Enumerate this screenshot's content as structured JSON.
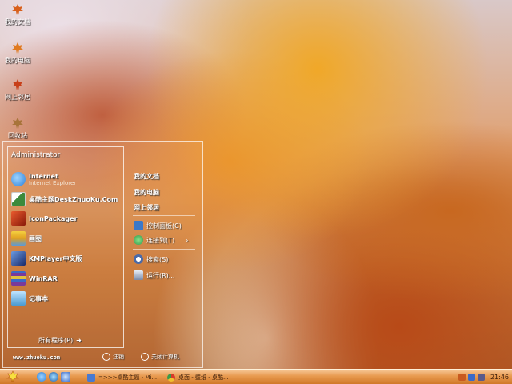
{
  "desktop": {
    "icons": [
      {
        "label": "我的文档",
        "icon": "maple-leaf-icon"
      },
      {
        "label": "我的电脑",
        "icon": "maple-leaf-icon"
      },
      {
        "label": "网上邻居",
        "icon": "maple-leaf-icon"
      },
      {
        "label": "回收站",
        "icon": "maple-leaf-icon"
      }
    ]
  },
  "start_menu": {
    "user": "Administrator",
    "programs": [
      {
        "title": "Internet",
        "subtitle": "Internet Explorer",
        "icon": "ie-icon",
        "color": "#2a7fd8"
      },
      {
        "title": "桌酷主题DeskZhuoKu.Com",
        "icon": "theme-icon",
        "color": "#3c8a3c"
      },
      {
        "title": "IconPackager",
        "icon": "iconpackager-icon",
        "color": "#c83a1e"
      },
      {
        "title": "画图",
        "icon": "paint-icon",
        "color": "#e0a020"
      },
      {
        "title": "KMPlayer中文版",
        "icon": "kmplayer-icon",
        "color": "#2a4a8a"
      },
      {
        "title": "WinRAR",
        "icon": "winrar-icon",
        "color": "#7a3a9a"
      },
      {
        "title": "记事本",
        "icon": "notepad-icon",
        "color": "#4a9ad0"
      }
    ],
    "all_programs": "所有程序(P)",
    "right_items": [
      {
        "label": "我的文档",
        "bold": true
      },
      {
        "label": "我的电脑",
        "bold": true
      },
      {
        "label": "网上邻居",
        "bold": true
      },
      {
        "label": "控制面板(C)",
        "bold": false,
        "icon": "control-panel-icon",
        "color": "#3a78c8"
      },
      {
        "label": "连接到(T)",
        "bold": false,
        "icon": "connect-icon",
        "color": "#2e9a4a"
      },
      {
        "label": "搜索(S)",
        "bold": false,
        "icon": "search-icon",
        "color": "#4a6aa8"
      },
      {
        "label": "运行(R)...",
        "bold": false,
        "icon": "run-icon",
        "color": "#7a8aa8"
      }
    ],
    "site": "www.zhuoku.com",
    "logoff": "注销",
    "shutdown": "关闭计算机"
  },
  "taskbar": {
    "tasks": [
      {
        "label": "=>>>桌酷主题 - Mi...",
        "icon": "window-icon"
      },
      {
        "label": "桌面 - 壁纸 - 桌酷...",
        "icon": "chrome-icon"
      }
    ],
    "clock": "21:46",
    "colors": {
      "taskbar": "#e89a50",
      "accent": "#d07828"
    }
  }
}
